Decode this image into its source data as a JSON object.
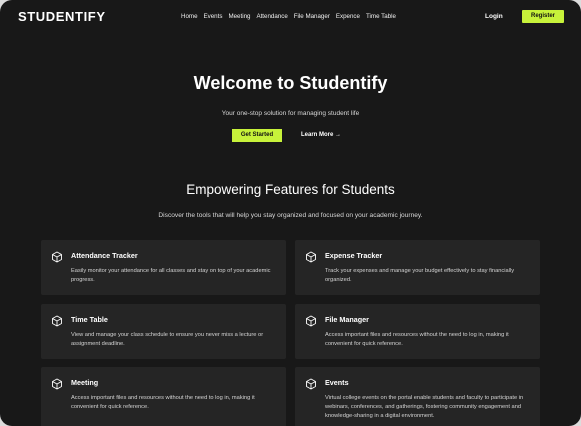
{
  "brand": "STUDENTIFY",
  "nav": {
    "links": [
      "Home",
      "Events",
      "Meeting",
      "Attendance",
      "File Manager",
      "Expence",
      "Time Table"
    ],
    "login": "Login",
    "register": "Register"
  },
  "hero": {
    "title": "Welcome to Studentify",
    "subtitle": "Your one-stop solution for managing student life",
    "primary_cta": "Get Started",
    "secondary_cta": "Learn More →"
  },
  "features_section": {
    "title": "Empowering Features for Students",
    "subtitle": "Discover the tools that will help you stay organized and focused on your academic journey."
  },
  "cards": [
    {
      "title": "Attendance Tracker",
      "desc": "Easily monitor your attendance for all classes and stay on top of your academic progress."
    },
    {
      "title": "Expense Tracker",
      "desc": "Track your expenses and manage your budget effectively to stay financially organized."
    },
    {
      "title": "Time Table",
      "desc": "View and manage your class schedule to ensure you never miss a lecture or assignment deadline."
    },
    {
      "title": "File Manager",
      "desc": "Access important files and resources without the need to log in, making it convenient for quick reference."
    },
    {
      "title": "Meeting",
      "desc": "Access important files and resources without the need to log in, making it convenient for quick reference."
    },
    {
      "title": "Events",
      "desc": "Virtual college events on the portal enable students and faculty to participate in webinars, conferences, and gatherings, fostering community engagement and knowledge-sharing in a digital environment."
    }
  ],
  "colors": {
    "accent": "#c7f23a",
    "background": "#181818",
    "card": "#252525"
  },
  "icons": {
    "card_icon": "cube-icon"
  }
}
